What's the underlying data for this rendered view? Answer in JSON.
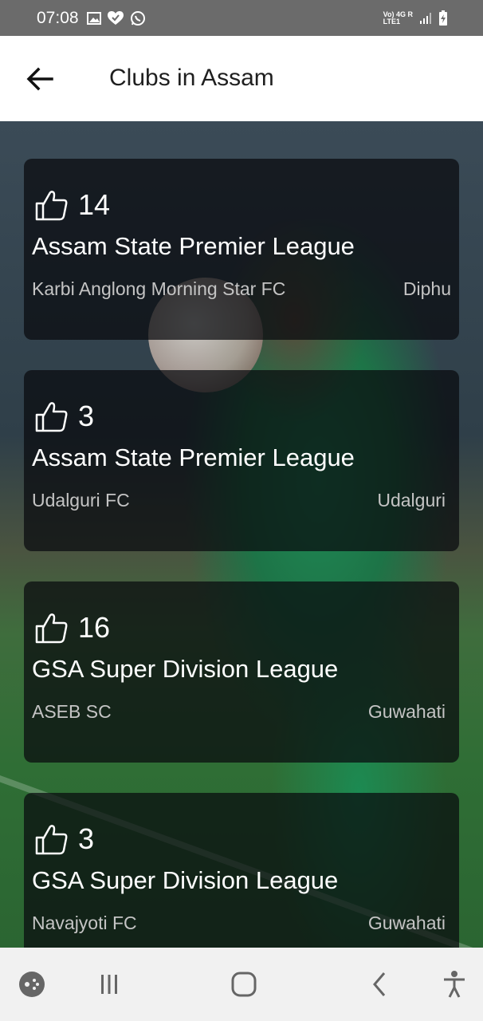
{
  "status_bar": {
    "time": "07:08",
    "network": {
      "line1": "Vo) 4G R",
      "line2": "LTE1"
    },
    "icons": [
      "gallery-icon",
      "heart-check-icon",
      "whatsapp-icon",
      "signal-icon",
      "battery-charging-icon"
    ]
  },
  "app_bar": {
    "title": "Clubs in Assam",
    "back_icon": "arrow-left-icon"
  },
  "clubs": [
    {
      "likes": "14",
      "league": "Assam State Premier League",
      "club": "Karbi Anglong Morning Star FC",
      "city": "Diphu"
    },
    {
      "likes": "3",
      "league": "Assam State Premier League",
      "club": "Udalguri FC",
      "city": "Udalguri"
    },
    {
      "likes": "16",
      "league": "GSA Super Division League",
      "club": "ASEB SC",
      "city": "Guwahati"
    },
    {
      "likes": "3",
      "league": "GSA Super Division League",
      "club": "Navajyoti FC",
      "city": "Guwahati"
    }
  ],
  "nav_bar": {
    "icons": [
      "game-launcher-icon",
      "recents-icon",
      "home-icon",
      "back-icon",
      "accessibility-icon"
    ]
  },
  "colors": {
    "status_bar": "#6b6b6b",
    "app_bar": "#ffffff",
    "card_bg": "rgba(8,10,14,0.72)",
    "nav_bar": "#f1f1f1"
  }
}
